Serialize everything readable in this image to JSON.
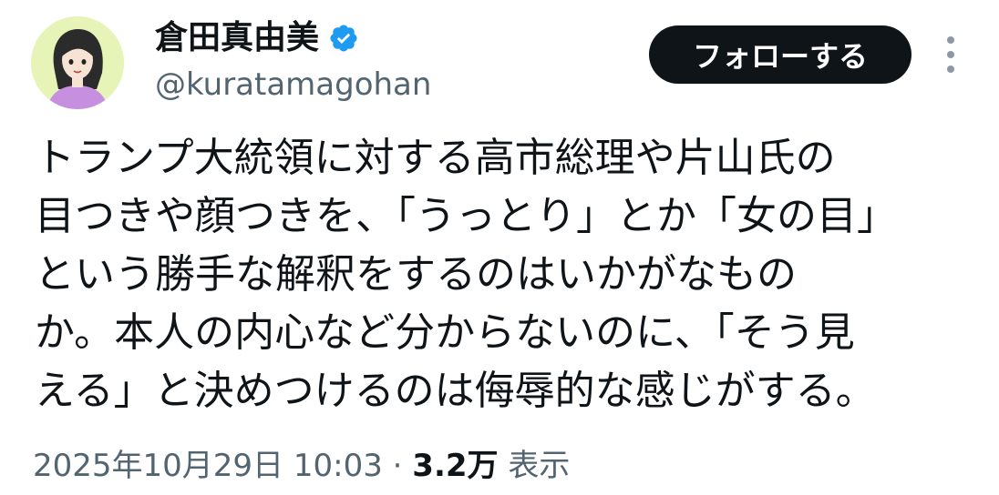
{
  "author": {
    "display_name": "倉田真由美",
    "handle": "@kuratamagohan",
    "verified": true
  },
  "follow_button_label": "フォローする",
  "more_icon": "more-vertical-icon",
  "tweet": {
    "lines": [
      "トランプ大統領に対する高市総理や片山氏の",
      "目つきや顔つきを、「うっとり」とか「女の目」",
      "という勝手な解釈をするのはいかがなもの",
      "か。本人の内心など分からないのに、「そう見",
      "える」と決めつけるのは侮辱的な感じがする。"
    ]
  },
  "meta": {
    "timestamp": "2025年10月29日 10:03",
    "separator": "·",
    "views_count": "3.2万",
    "views_label": "表示"
  },
  "colors": {
    "text_primary": "#0f1419",
    "text_secondary": "#536471",
    "verified_blue": "#1d9bf0",
    "follow_bg": "#0f1419",
    "avatar_bg": "#e6f4b8"
  }
}
